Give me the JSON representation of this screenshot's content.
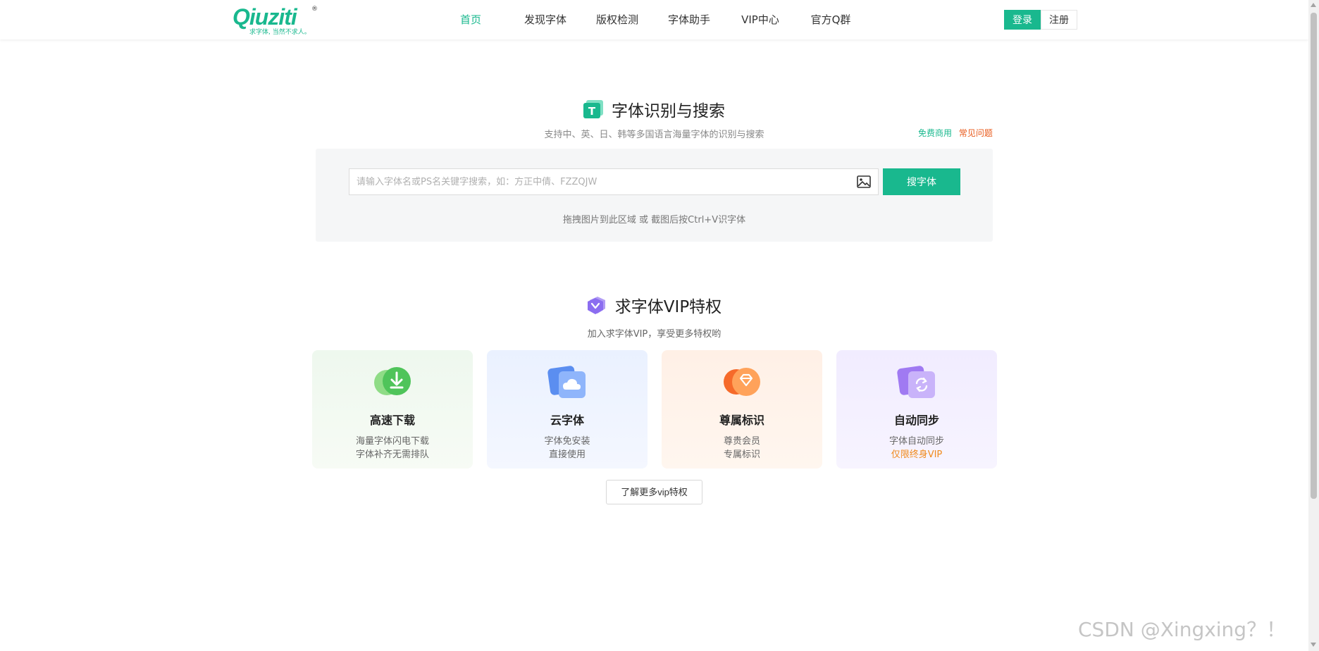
{
  "brand": {
    "name": "Qiuziti",
    "registered": "®",
    "tagline": "求字体, 当然不求人。"
  },
  "nav": {
    "items": [
      {
        "label": "首页",
        "active": true
      },
      {
        "label": "发现字体"
      },
      {
        "label": "版权检测"
      },
      {
        "label": "字体助手"
      },
      {
        "label": "VIP中心"
      },
      {
        "label": "官方Q群"
      }
    ]
  },
  "auth": {
    "login": "登录",
    "register": "注册"
  },
  "search": {
    "title": "字体识别与搜索",
    "subtitle": "支持中、英、日、韩等多国语言海量字体的识别与搜索",
    "link_free": "免费商用",
    "link_faq": "常见问题",
    "placeholder": "请输入字体名或PS名关键字搜索，如：方正中倩、FZZQJW",
    "button": "搜字体",
    "hint": "拖拽图片到此区域 或 截图后按Ctrl+V识字体"
  },
  "vip": {
    "title": "求字体VIP特权",
    "subtitle": "加入求字体VIP，享受更多特权哟",
    "cards": [
      {
        "title": "高速下载",
        "line1": "海量字体闪电下载",
        "line2": "字体补齐无需排队",
        "icon": "download-icon"
      },
      {
        "title": "云字体",
        "line1": "字体免安装",
        "line2": "直接使用",
        "icon": "cloud-icon"
      },
      {
        "title": "尊属标识",
        "line1": "尊贵会员",
        "line2": "专属标识",
        "icon": "diamond-icon"
      },
      {
        "title": "自动同步",
        "line1": "字体自动同步",
        "line2": "仅限终身VIP",
        "icon": "sync-icon"
      }
    ],
    "more_button": "了解更多vip特权"
  },
  "watermark": "CSDN @Xingxing？！",
  "colors": {
    "accent": "#19b88e",
    "orange": "#f08a1c",
    "faq": "#e8591a"
  }
}
